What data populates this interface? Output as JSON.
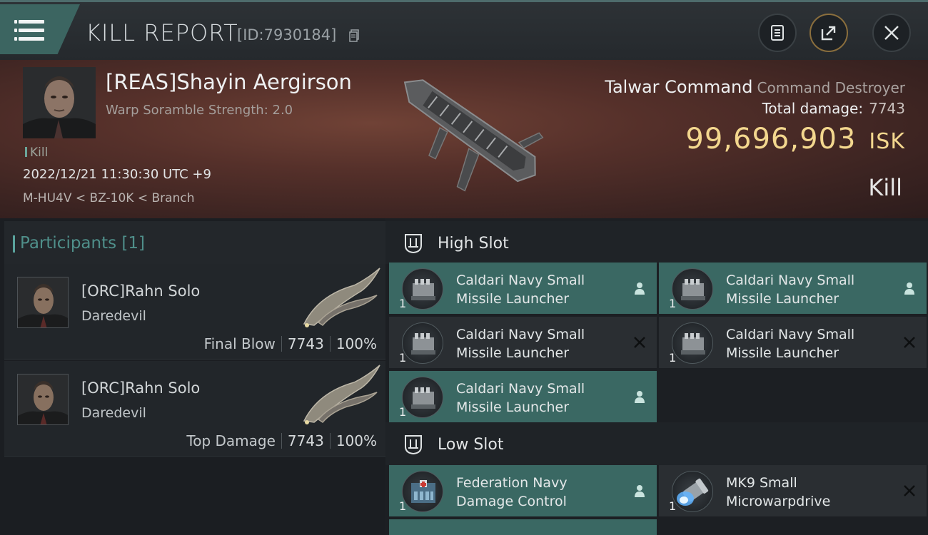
{
  "header": {
    "title": "KILL REPORT",
    "id_label": "[ID:7930184]"
  },
  "victim": {
    "name": "[REAS]Shayin Aergirson",
    "warp_scramble": "Warp Soramble Strength: 2.0",
    "kill_tag": "Kill",
    "datetime": "2022/12/21 11:30:30 UTC +9",
    "location": "M-HU4V < BZ-10K < Branch",
    "ship_name": "Talwar Command",
    "ship_class": "Command Destroyer",
    "total_damage_label": "Total damage:",
    "total_damage_value": "7743",
    "isk_value": "99,696,903",
    "isk_unit": "ISK",
    "result": "Kill"
  },
  "participants": {
    "header": "Participants [1]",
    "items": [
      {
        "name": "[ORC]Rahn Solo",
        "ship": "Daredevil",
        "role": "Final Blow",
        "damage": "7743",
        "percent": "100%"
      },
      {
        "name": "[ORC]Rahn Solo",
        "ship": "Daredevil",
        "role": "Top Damage",
        "damage": "7743",
        "percent": "100%"
      }
    ]
  },
  "slots": {
    "high": {
      "title": "High Slot",
      "items": [
        {
          "name_line1": "Caldari Navy Small",
          "name_line2": "Missile Launcher",
          "qty": "1",
          "state": "dropped"
        },
        {
          "name_line1": "Caldari Navy Small",
          "name_line2": "Missile Launcher",
          "qty": "1",
          "state": "dropped"
        },
        {
          "name_line1": "Caldari Navy Small",
          "name_line2": "Missile Launcher",
          "qty": "1",
          "state": "destroyed"
        },
        {
          "name_line1": "Caldari Navy Small",
          "name_line2": "Missile Launcher",
          "qty": "1",
          "state": "destroyed"
        },
        {
          "name_line1": "Caldari Navy Small",
          "name_line2": "Missile Launcher",
          "qty": "1",
          "state": "dropped"
        }
      ]
    },
    "low": {
      "title": "Low Slot",
      "items": [
        {
          "name_line1": "Federation Navy",
          "name_line2": "Damage Control",
          "qty": "1",
          "state": "dropped"
        },
        {
          "name_line1": "MK9 Small",
          "name_line2": "Microwarpdrive",
          "qty": "1",
          "state": "destroyed"
        }
      ]
    }
  },
  "icons": {
    "menu": "hamburger-menu-icon",
    "copy": "copy-icon",
    "notes": "clipboard-icon",
    "share": "share-icon",
    "close": "close-icon",
    "dropped": "person-icon",
    "destroyed": "x-icon",
    "slot": "slot-badge-icon"
  },
  "colors": {
    "accent": "#3a6863",
    "isk": "#f3d78e",
    "hero_bg": "#55302a"
  }
}
